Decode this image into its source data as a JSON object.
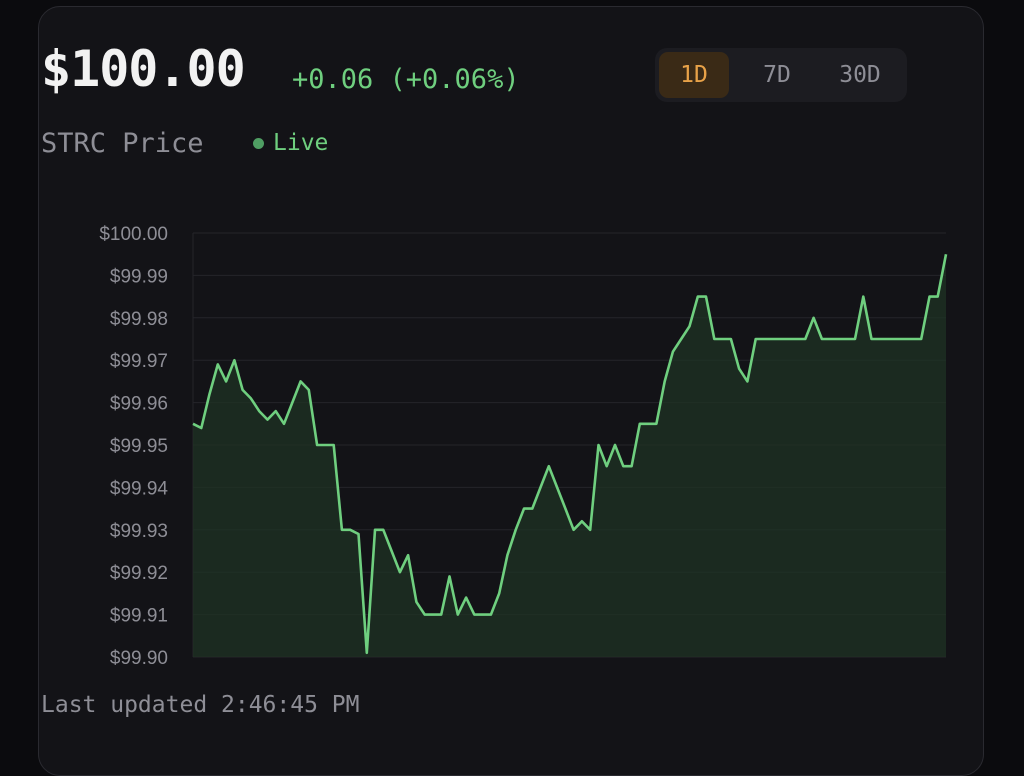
{
  "header": {
    "price": "$100.00",
    "change": "+0.06 (+0.06%)",
    "title": "STRC Price",
    "live_label": "Live"
  },
  "range_selector": {
    "options": [
      "1D",
      "7D",
      "30D"
    ],
    "selected": "1D"
  },
  "footer": {
    "updated": "Last updated 2:46:45 PM"
  },
  "colors": {
    "accent_green": "#6fcf7f",
    "active_tab": "#e8a248",
    "line": "#6fcf7f",
    "fill": "#1f3324"
  },
  "chart_data": {
    "type": "area",
    "title": "",
    "xlabel": "",
    "ylabel": "",
    "ylim": [
      99.9,
      100.0
    ],
    "yticks": [
      "$100.00",
      "$99.99",
      "$99.98",
      "$99.97",
      "$99.96",
      "$99.95",
      "$99.94",
      "$99.93",
      "$99.92",
      "$99.91",
      "$99.90"
    ],
    "ytick_values": [
      100.0,
      99.99,
      99.98,
      99.97,
      99.96,
      99.95,
      99.94,
      99.93,
      99.92,
      99.91,
      99.9
    ],
    "grid": true,
    "series": [
      {
        "values": [
          99.955,
          99.954,
          99.962,
          99.969,
          99.965,
          99.97,
          99.963,
          99.961,
          99.958,
          99.956,
          99.958,
          99.955,
          99.96,
          99.965,
          99.963,
          99.95,
          99.95,
          99.95,
          99.93,
          99.93,
          99.929,
          99.901,
          99.93,
          99.93,
          99.925,
          99.92,
          99.924,
          99.913,
          99.91,
          99.91,
          99.91,
          99.919,
          99.91,
          99.914,
          99.91,
          99.91,
          99.91,
          99.915,
          99.924,
          99.93,
          99.935,
          99.935,
          99.94,
          99.945,
          99.94,
          99.935,
          99.93,
          99.932,
          99.93,
          99.95,
          99.945,
          99.95,
          99.945,
          99.945,
          99.955,
          99.955,
          99.955,
          99.965,
          99.972,
          99.975,
          99.978,
          99.985,
          99.985,
          99.975,
          99.975,
          99.975,
          99.968,
          99.965,
          99.975,
          99.975,
          99.975,
          99.975,
          99.975,
          99.975,
          99.975,
          99.98,
          99.975,
          99.975,
          99.975,
          99.975,
          99.975,
          99.985,
          99.975,
          99.975,
          99.975,
          99.975,
          99.975,
          99.975,
          99.975,
          99.985,
          99.985,
          99.995
        ]
      }
    ]
  }
}
